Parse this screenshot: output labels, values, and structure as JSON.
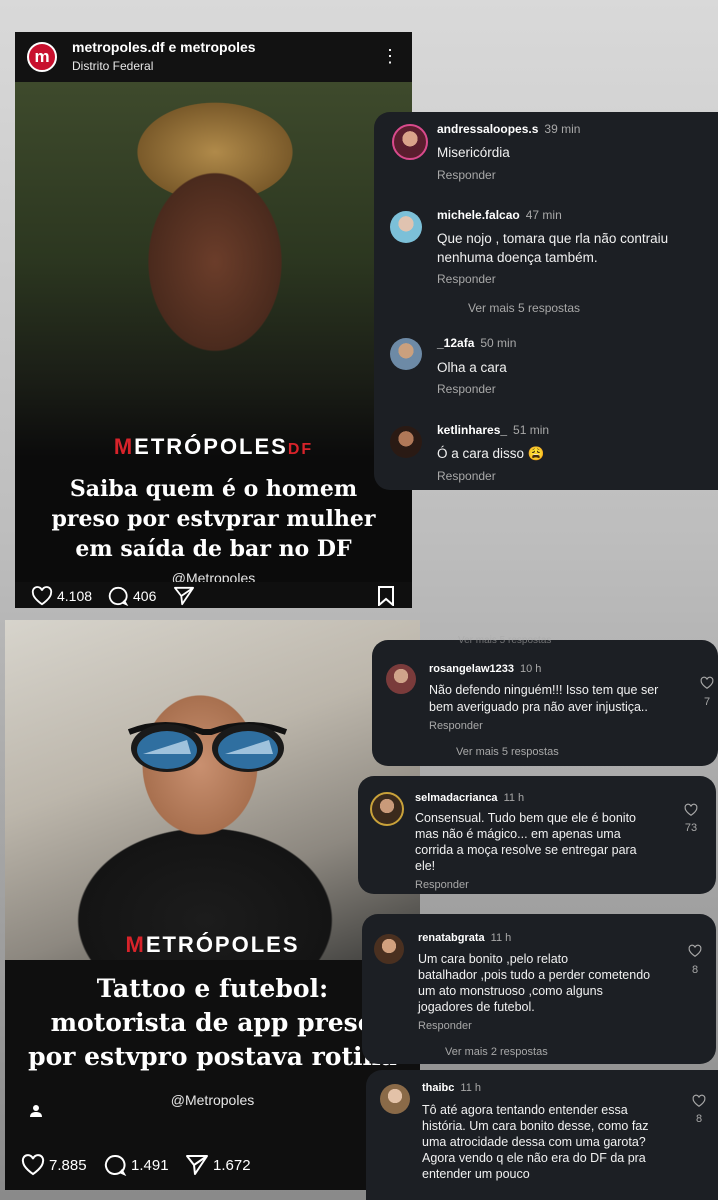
{
  "post1": {
    "account": "metropoles.df e metropoles",
    "location": "Distrito Federal",
    "logo_letter": "m",
    "brand_first": "M",
    "brand_rest": "ETRÓPOLES",
    "brand_suffix": "DF",
    "headline_lines": [
      "Saiba quem é o homem",
      "preso por estvprar mulher",
      "em saída de bar no DF"
    ],
    "handle": "@Metropoles",
    "likes": "4.108",
    "comments": "406"
  },
  "comments1": [
    {
      "user": "andressaloopes.s",
      "time": "39 min",
      "text": [
        "Misericórdia"
      ],
      "reply": "Responder"
    },
    {
      "user": "michele.falcao",
      "time": "47 min",
      "text": [
        "Que nojo , tomara que rla não contraiu",
        "nenhuma doença também."
      ],
      "reply": "Responder"
    },
    {
      "user": "_12afa",
      "time": "50 min",
      "text": [
        "Olha a cara"
      ],
      "reply": "Responder"
    },
    {
      "user": "ketlinhares_",
      "time": "51 min",
      "text": [
        "Ó a cara disso 😩"
      ],
      "reply": "Responder"
    }
  ],
  "comments1_more": "Ver mais 5 respostas",
  "post2": {
    "brand_first": "M",
    "brand_rest": "ETRÓPOLES",
    "headline_lines": [
      "Tattoo e futebol:",
      "motorista de app preso",
      "por estvpro postava rotina"
    ],
    "handle": "@Metropoles",
    "likes": "7.885",
    "comments": "1.491",
    "shares": "1.672"
  },
  "comments2": [
    {
      "user": "rosangelaw1233",
      "time": "10 h",
      "text": [
        "Não defendo ninguém!!! Isso tem que ser",
        "bem averiguado pra não aver injustiça.."
      ],
      "reply": "Responder",
      "likes": "7",
      "more": "Ver mais 5 respostas",
      "more_top": "Ver mais 5 respostas"
    },
    {
      "user": "selmadacrianca",
      "time": "11 h",
      "text": [
        "Consensual. Tudo bem que ele é bonito",
        "mas não é mágico... em apenas uma",
        "corrida a moça resolve se entregar para",
        "ele!"
      ],
      "reply": "Responder",
      "likes": "73"
    },
    {
      "user": "renatabgrata",
      "time": "11 h",
      "text": [
        "Um cara bonito ,pelo relato",
        "batalhador ,pois tudo a perder cometendo",
        "um ato monstruoso ,como alguns",
        "jogadores de futebol."
      ],
      "reply": "Responder",
      "likes": "8",
      "more": "Ver mais 2 respostas"
    },
    {
      "user": "thaibc",
      "time": "11 h",
      "text": [
        "Tô até agora tentando entender essa",
        "história. Um cara bonito desse, como faz",
        "uma atrocidade dessa com uma garota?",
        "Agora vendo q ele não era do DF da pra",
        "entender um pouco"
      ],
      "likes": "8"
    }
  ]
}
